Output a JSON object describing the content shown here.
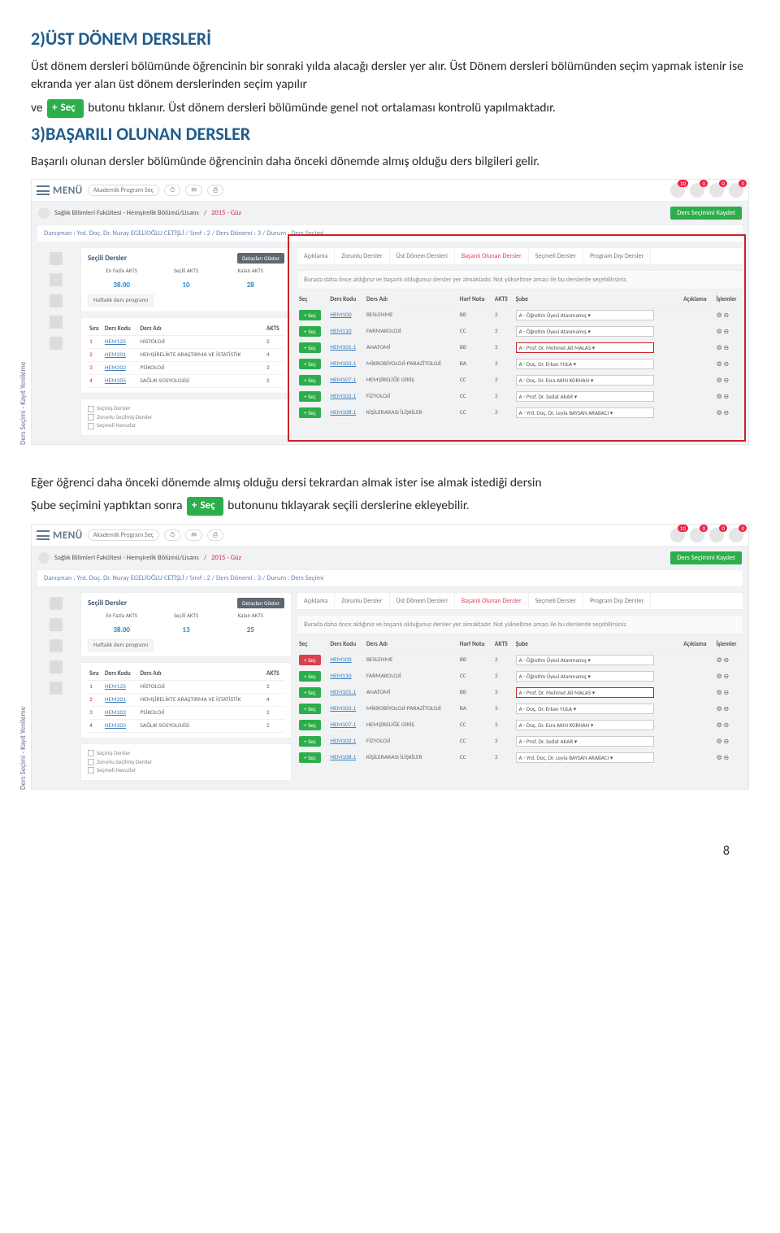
{
  "section2": {
    "title": "2)ÜST DÖNEM DERSLERİ",
    "p1": "Üst dönem dersleri bölümünde öğrencinin bir sonraki yılda alacağı dersler yer alır. Üst Dönem dersleri bölümünden seçim yapmak istenir ise ekranda yer alan üst dönem derslerinden seçim yapılır",
    "p2a": "ve ",
    "p2btn": "Seç",
    "p2b": " butonu tıklanır. Üst dönem dersleri bölümünde genel not ortalaması kontrolü yapılmaktadır."
  },
  "section3": {
    "title": "3)BAŞARILI OLUNAN DERSLER",
    "p1": "Başarılı olunan dersler bölümünde öğrencinin daha önceki dönemde almış olduğu ders bilgileri gelir."
  },
  "between": {
    "p1": "Eğer öğrenci daha önceki dönemde almış olduğu dersi tekrardan almak ister ise almak istediği dersin",
    "p2a": "Şube seçimini yaptıktan sonra ",
    "p2btn": "Seç",
    "p2b": "butonunu tıklayarak seçili derslerine ekleyebilir."
  },
  "common": {
    "menu": "MENÜ",
    "akademik": "Akademik Program Seç",
    "noti_badge": "10",
    "noti_z1": "0",
    "noti_z2": "0",
    "noti_z3": "0",
    "crumb_left": "Sağlık Bilimleri Fakültesi - Hemşirelik Bölümü/Lisans",
    "crumb_right": "2015 - Güz",
    "save": "Ders Seçimini Kaydet",
    "subcrumb": "Danışman : Yrd. Doç. Dr. Nuray EGELİOĞLU CETİŞLİ / Sınıf : 2 / Ders Dönemi : 3 / Durum : Ders Seçimi",
    "secili_title": "Seçili Dersler",
    "detay": "Detayları Göster",
    "akts_labels": [
      "En Fazla AKTS",
      "Seçili AKTS",
      "Kalan AKTS"
    ],
    "akts_vals": [
      "38.00",
      "10",
      "28"
    ],
    "akts_vals_b": [
      "38.00",
      "13",
      "25"
    ],
    "haftalik": "Haftalık ders programı",
    "mini_head": [
      "Sıra",
      "Ders Kodu",
      "Ders Adı",
      "AKTS"
    ],
    "mini_rows": [
      [
        "1",
        "HEM125",
        "HİSTOLOJİ",
        "2"
      ],
      [
        "2",
        "HEM201",
        "HEMŞİRELİKTE ARAŞTIRMA VE İSTATİSTİK",
        "4"
      ],
      [
        "3",
        "HEM202",
        "PSİKOLOJİ",
        "2"
      ],
      [
        "4",
        "HEM205",
        "SAĞLIK SOSYOLOJİSİ",
        "2"
      ]
    ],
    "legend": [
      "Seçmiş Dersler",
      "Zorunlu Seçilmiş Dersler",
      "Seçmeli Havuzlar"
    ],
    "tabs": [
      "Açıklama",
      "Zorunlu Dersler",
      "Üst Dönem Dersleri",
      "Başarılı Olunan Dersler",
      "Seçmeli Dersler",
      "Program Dışı Dersler"
    ],
    "infobox": "Burada daha önce aldığınız ve başarılı olduğunuz dersler yer almaktadır. Not yükseltme amacı ile bu derslerde seçebilirsiniz.",
    "big_head": [
      "Seç",
      "Ders Kodu",
      "Ders Adı",
      "Harf Notu",
      "AKTS",
      "Şube",
      "Açıklama",
      "İşlemler"
    ],
    "rows": [
      {
        "code": "HEM100",
        "name": "BESLENME",
        "g": "BB",
        "a": "2",
        "sube": "A - Öğretim Üyesi Atanmamış"
      },
      {
        "code": "HEM110",
        "name": "FARMAKOLOJİ",
        "g": "CC",
        "a": "2",
        "sube": "A - Öğretim Üyesi Atanmamış"
      },
      {
        "code": "HEM101.1",
        "name": "ANATOMİ",
        "g": "BB",
        "a": "3",
        "sube": "A - Prof. Dr. Mehmet Ali MALAS",
        "hi": true
      },
      {
        "code": "HEM103.1",
        "name": "MİKROBİYOLOJİ-PARAZİTOLOJİ",
        "g": "BA",
        "a": "3",
        "sube": "A - Doç. Dr. Erkan YULA"
      },
      {
        "code": "HEM107.1",
        "name": "HEMŞİRELİĞE GİRİŞ",
        "g": "CC",
        "a": "2",
        "sube": "A - Doç. Dr. Esra AKIN KORHAN"
      },
      {
        "code": "HEM102.1",
        "name": "FİZYOLOJİ",
        "g": "CC",
        "a": "2",
        "sube": "A - Prof. Dr. Sedat AKAR"
      },
      {
        "code": "HEM108.1",
        "name": "KİŞİLERARASI İLİŞKİLER",
        "g": "CC",
        "a": "2",
        "sube": "A - Yrd. Doç. Dr. Leyla BAYSAN ARABACI"
      }
    ],
    "vrot": "Ders Seçimi - Kayıt Yenileme",
    "icons": "⚙ ⊖"
  },
  "page_number": "8"
}
